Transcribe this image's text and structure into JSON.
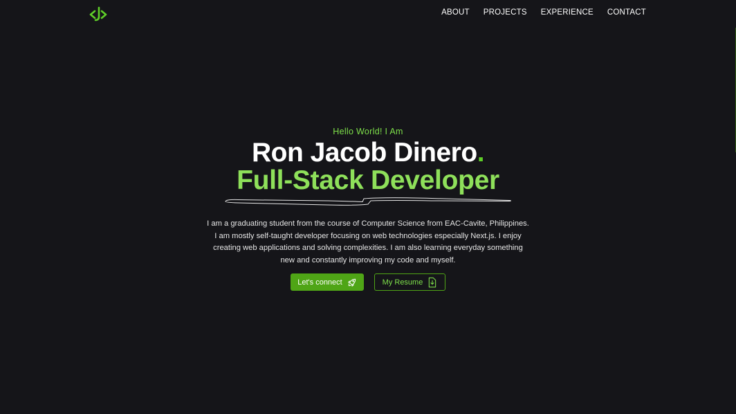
{
  "nav": {
    "logo_icon": "code-bracket-logo-icon",
    "links": [
      {
        "label": "ABOUT"
      },
      {
        "label": "PROJECTS"
      },
      {
        "label": "EXPERIENCE"
      },
      {
        "label": "CONTACT"
      }
    ]
  },
  "hero": {
    "greeting": "Hello World! I Am",
    "name": "Ron Jacob Dinero",
    "name_dot": ".",
    "role": "Full-Stack Developer",
    "bio": "I am a graduating student from the course of Computer Science from EAC-Cavite, Philippines. I am mostly self-taught developer focusing on web technologies especially Next.js. I enjoy creating web applications and solving complexities. I am also learning everyday something new and constantly improving my code and myself.",
    "primary_button": {
      "label": "Let's connect",
      "icon": "rocket-icon"
    },
    "secondary_button": {
      "label": "My Resume",
      "icon": "download-file-icon"
    }
  },
  "colors": {
    "background": "#151519",
    "accent": "#7ee04a",
    "accent_dark": "#4fa516",
    "text": "#ffffff"
  }
}
